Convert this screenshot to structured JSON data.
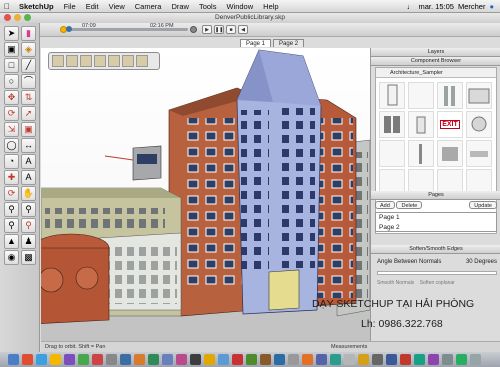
{
  "menubar": {
    "apple": "",
    "items": [
      "SketchUp",
      "File",
      "Edit",
      "View",
      "Camera",
      "Draw",
      "Tools",
      "Window",
      "Help"
    ],
    "clock": "mar. 15:05",
    "user": "Mercher"
  },
  "window": {
    "title": "DenverPublicLibrary.skp"
  },
  "scene_controls": {
    "time_start": "07:09",
    "time_end": "02:16 PM"
  },
  "tabs": [
    {
      "label": "Page 1"
    },
    {
      "label": "Page 2"
    }
  ],
  "panels": {
    "layers_title": "Layers",
    "component_browser_title": "Component Browser",
    "component_collection": "Architecture_Sampler",
    "exit_sign": "EXIT",
    "pages_title": "Pages",
    "pages_add": "Add",
    "pages_delete": "Delete",
    "pages_update": "Update",
    "pages_list": [
      "Page 1",
      "Page 2"
    ],
    "soften_title": "Soften/Smooth Edges",
    "angle_label": "Angle Between Normals",
    "angle_value": "30  Degrees",
    "smooth_normals": "Smooth Normals",
    "soften_coplanar": "Soften coplanar"
  },
  "status": {
    "hint": "Drag to orbit.  Shift = Pan",
    "measurements": "Measurements"
  },
  "overlay": {
    "line1": "DẠY SKETCHUP TẠI HẢI PHÒNG",
    "line2": "Lh: 0986.322.768"
  },
  "colors": {
    "brick": "#b75a3a",
    "tower": "#a7b4e0",
    "sky": "#ffffff",
    "ground": "#b9b9b9",
    "exit_red": "#c4001a"
  }
}
